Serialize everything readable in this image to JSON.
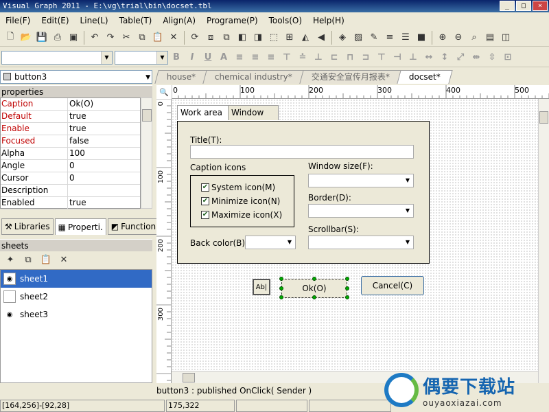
{
  "window": {
    "title": "Visual Graph 2011 - E:\\vg\\trial\\bin\\docset.tbl"
  },
  "menu": [
    "File(F)",
    "Edit(E)",
    "Line(L)",
    "Table(T)",
    "Align(A)",
    "Programe(P)",
    "Tools(O)",
    "Help(H)"
  ],
  "object_selector": {
    "value": "button3"
  },
  "properties_header": "properties",
  "properties": [
    {
      "key": "Caption",
      "value": "Ok(O)"
    },
    {
      "key": "Default",
      "value": "true"
    },
    {
      "key": "Enable",
      "value": "true"
    },
    {
      "key": "Focused",
      "value": "false"
    },
    {
      "key": "Alpha",
      "value": "100"
    },
    {
      "key": "Angle",
      "value": "0"
    },
    {
      "key": "Cursor",
      "value": "0"
    },
    {
      "key": "Description",
      "value": ""
    },
    {
      "key": "Enabled",
      "value": "true"
    }
  ],
  "panel_tabs": [
    "Libraries",
    "Properti.",
    "Function"
  ],
  "sheets_header": "sheets",
  "sheets": [
    "sheet1",
    "sheet2",
    "sheet3"
  ],
  "doc_tabs": [
    "house*",
    "chemical industry*",
    "交通安全宣传月报表*",
    "docset*"
  ],
  "ruler_h": [
    "0",
    "100",
    "200",
    "300",
    "400",
    "500"
  ],
  "ruler_v": [
    "0",
    "100",
    "200",
    "300"
  ],
  "dialog": {
    "tabs": [
      "Work area",
      "Window"
    ],
    "title_label": "Title(T):",
    "caption_icons_label": "Caption icons",
    "checks": [
      "System icon(M)",
      "Minimize icon(N)",
      "Maximize icon(X)"
    ],
    "back_color_label": "Back color(B):",
    "window_size_label": "Window size(F):",
    "border_label": "Border(D):",
    "scrollbar_label": "Scrollbar(S):"
  },
  "buttons": {
    "small": "Ab|",
    "ok": "Ok(O)",
    "cancel": "Cancel(C)"
  },
  "status_message": "button3 : published OnClick( Sender )",
  "statusbar": [
    "[164,256]-[92,28]",
    "175,322"
  ],
  "watermark": {
    "cn": "偶要下载站",
    "en": "ouyaoxiazai.com"
  }
}
